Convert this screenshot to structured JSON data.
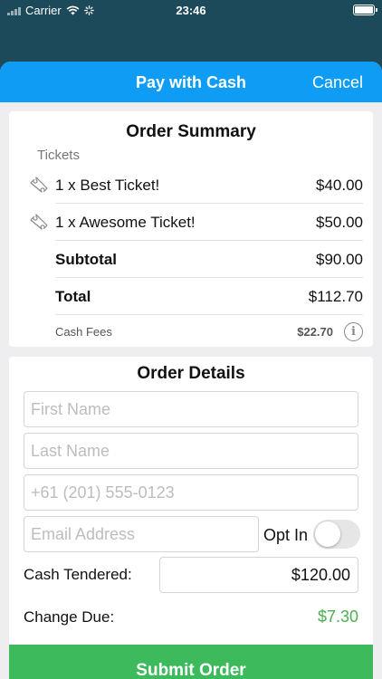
{
  "status_bar": {
    "carrier": "Carrier",
    "time": "23:46"
  },
  "header": {
    "title": "Pay with Cash",
    "cancel_label": "Cancel"
  },
  "order_summary": {
    "title": "Order Summary",
    "section_label": "Tickets",
    "items": [
      {
        "label": "1 x Best Ticket!",
        "price": "$40.00"
      },
      {
        "label": "1 x Awesome Ticket!",
        "price": "$50.00"
      }
    ],
    "subtotal_label": "Subtotal",
    "subtotal_value": "$90.00",
    "total_label": "Total",
    "total_value": "$112.70",
    "fees_label": "Cash Fees",
    "fees_value": "$22.70"
  },
  "order_details": {
    "title": "Order Details",
    "first_name_placeholder": "First Name",
    "last_name_placeholder": "Last Name",
    "phone_placeholder": "+61 (201) 555-0123",
    "email_placeholder": "Email Address",
    "opt_in_label": "Opt In",
    "opt_in_checked": false,
    "cash_tendered_label": "Cash Tendered:",
    "cash_tendered_value": "$120.00",
    "change_due_label": "Change Due:",
    "change_due_value": "$7.30",
    "change_due_color": "#4caf50"
  },
  "submit_label": "Submit Order",
  "colors": {
    "nav_bar": "#0f9cf5",
    "submit_button": "#3dbb5c",
    "background": "#1d4a5a"
  }
}
